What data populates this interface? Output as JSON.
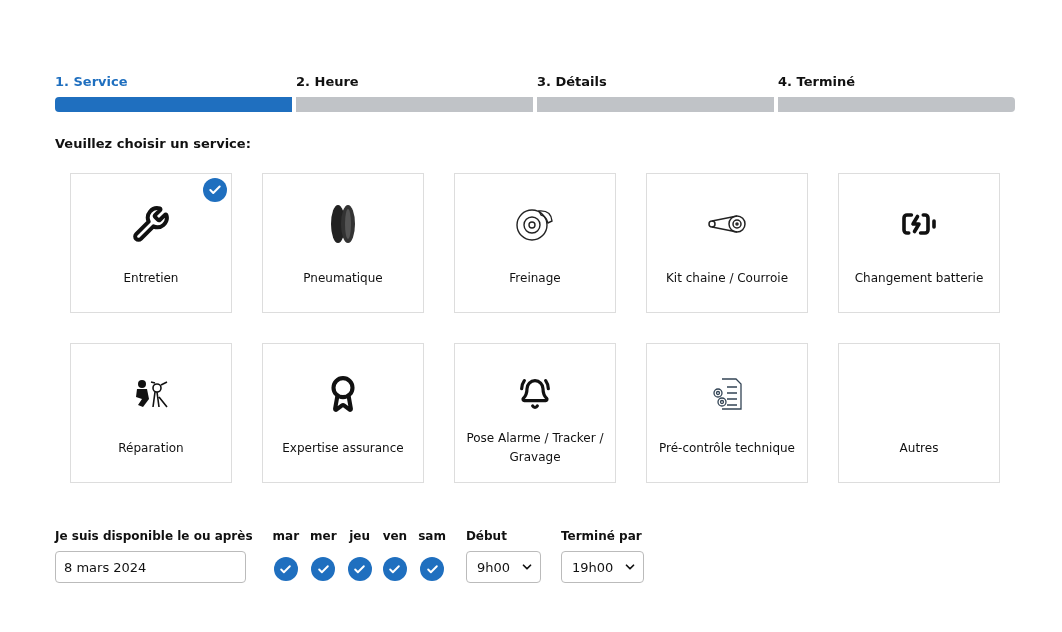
{
  "steps": [
    {
      "label": "1. Service",
      "selected": true
    },
    {
      "label": "2. Heure",
      "selected": false
    },
    {
      "label": "3. Détails",
      "selected": false
    },
    {
      "label": "4. Terminé",
      "selected": false
    }
  ],
  "prompt": "Veuillez choisir un service:",
  "services": [
    {
      "label": "Entretien",
      "selected": true
    },
    {
      "label": "Pneumatique",
      "selected": false
    },
    {
      "label": "Freinage",
      "selected": false
    },
    {
      "label": "Kit chaine / Courroie",
      "selected": false
    },
    {
      "label": "Changement batterie",
      "selected": false
    },
    {
      "label": "Réparation",
      "selected": false
    },
    {
      "label": "Expertise assurance",
      "selected": false
    },
    {
      "label": "Pose Alarme / Tracker / Gravage",
      "selected": false
    },
    {
      "label": "Pré-contrôle technique",
      "selected": false
    },
    {
      "label": "Autres",
      "selected": false
    }
  ],
  "availability": {
    "label": "Je suis disponible le ou après",
    "value": "8 mars 2024"
  },
  "days": [
    {
      "label": "mar",
      "checked": true
    },
    {
      "label": "mer",
      "checked": true
    },
    {
      "label": "jeu",
      "checked": true
    },
    {
      "label": "ven",
      "checked": true
    },
    {
      "label": "sam",
      "checked": true
    }
  ],
  "start": {
    "label": "Début",
    "value": "9h00"
  },
  "end": {
    "label": "Terminé par",
    "value": "19h00"
  }
}
